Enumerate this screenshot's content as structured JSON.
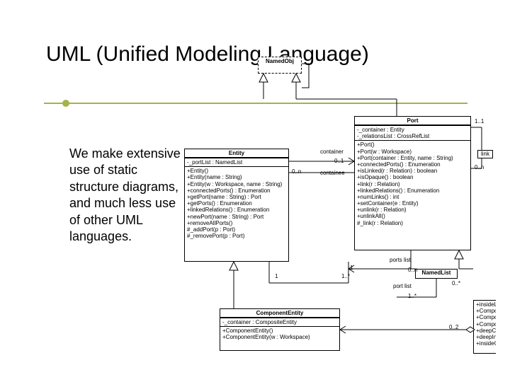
{
  "title": "UML (Unified Modeling Language)",
  "body": "We make extensive use of static structure diagrams, and much less use of other UML languages.",
  "classes": {
    "namedObj": {
      "name": "NamedObj"
    },
    "entity": {
      "name": "Entity",
      "attrs": "-_portList : NamedList",
      "ops": "+Entity()\n+Entity(name : String)\n+Entity(w : Workspace, name : String)\n+connectedPorts() : Enumeration\n+getPort(name : String) : Port\n+getPorts() : Enumeration\n+linkedRelations() : Enumeration\n+newPort(name : String) : Port\n+removeAllPorts()\n#_addPort(p : Port)\n#_removePort(p : Port)"
    },
    "port": {
      "name": "Port",
      "attrs": "-_container : Entity\n-_relationsList : CrossRefList",
      "ops": "+Port()\n+Port(w : Workspace)\n+Port(container : Entity, name : String)\n+connectedPorts() : Enumeration\n+isLinked(r : Relation) : boolean\n+isOpaque() : boolean\n+link(r : Relation)\n+linkedRelations() : Enumeration\n+numLinks() : int\n+setContainer(e : Entity)\n+unlink(r : Relation)\n+unlinkAll()\n#_link(r : Relation)"
    },
    "componentEntity": {
      "name": "ComponentEntity",
      "attrs": "-_container : CompositeEntity",
      "ops": "+ComponentEntity()\n+ComponentEntity(w : Workspace)"
    },
    "namedList": {
      "name": "NamedList"
    },
    "link": {
      "name": "link"
    },
    "compositeEntity": {
      "attrs": "+insideLinks() : C\n+ComponentPo\n+ComponentPo\n+ComponentPo\n+deepConnect\n+deepInsidePo\n+insideComp"
    }
  },
  "labels": {
    "container": "container",
    "containee": "containee",
    "portList": "ports list",
    "portList2": "port list",
    "m01": "0..1",
    "m0n": "0..n",
    "m1": "1",
    "m11": "1..1",
    "m1s": "1..*",
    "m0s": "0..*",
    "m02": "0..2"
  }
}
